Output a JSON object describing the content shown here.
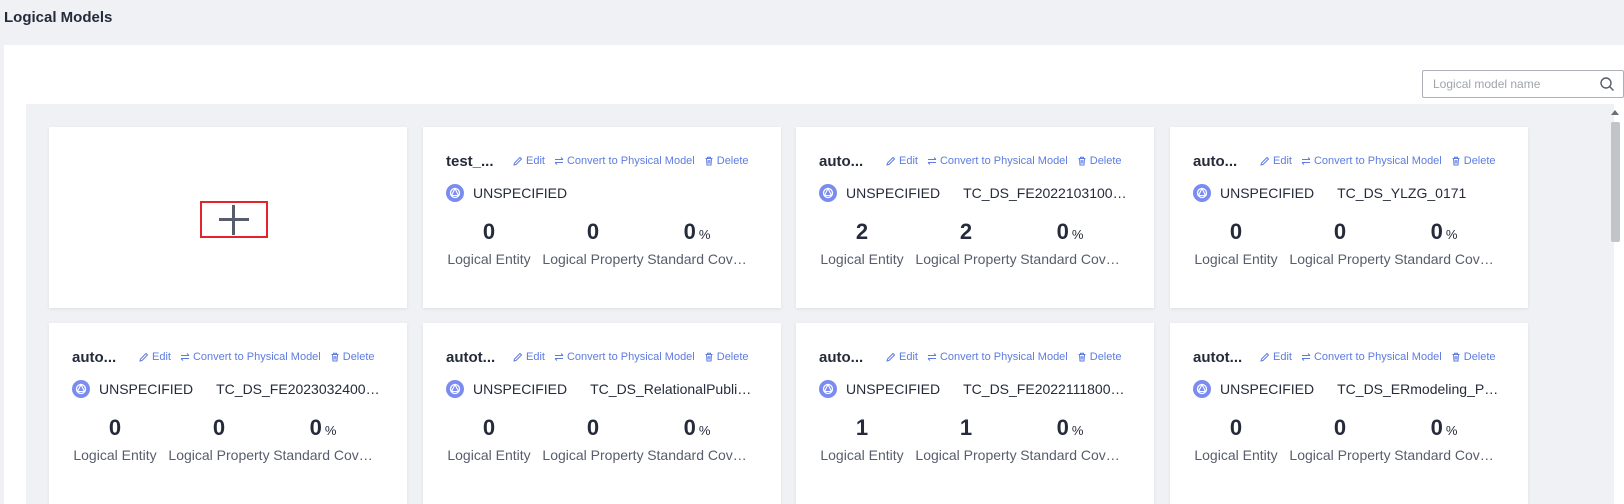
{
  "page": {
    "title": "Logical Models"
  },
  "search": {
    "placeholder": "Logical model name"
  },
  "labels": {
    "edit": "Edit",
    "convert": "Convert to Physical Model",
    "delete": "Delete",
    "entity": "Logical Entity",
    "property": "Logical Property",
    "coverage": "Standard Cov…",
    "percent": "%"
  },
  "cards": [
    {
      "name": "test_...",
      "status": "UNSPECIFIED",
      "datasource": "",
      "entity": "0",
      "property": "0",
      "coverage": "0"
    },
    {
      "name": "auto...",
      "status": "UNSPECIFIED",
      "datasource": "TC_DS_FE20221031003...",
      "entity": "2",
      "property": "2",
      "coverage": "0"
    },
    {
      "name": "auto...",
      "status": "UNSPECIFIED",
      "datasource": "TC_DS_YLZG_0171",
      "entity": "0",
      "property": "0",
      "coverage": "0"
    },
    {
      "name": "auto...",
      "status": "UNSPECIFIED",
      "datasource": "TC_DS_FE20230324001...",
      "entity": "0",
      "property": "0",
      "coverage": "0"
    },
    {
      "name": "autot...",
      "status": "UNSPECIFIED",
      "datasource": "TC_DS_RelationalPublish...",
      "entity": "0",
      "property": "0",
      "coverage": "0"
    },
    {
      "name": "auto...",
      "status": "UNSPECIFIED",
      "datasource": "TC_DS_FE20221118000...",
      "entity": "1",
      "property": "1",
      "coverage": "0"
    },
    {
      "name": "autot...",
      "status": "UNSPECIFIED",
      "datasource": "TC_DS_ERmodeling_Phy...",
      "entity": "0",
      "property": "0",
      "coverage": "0"
    }
  ],
  "colors": {
    "link": "#5e7ce0",
    "accent_border": "#e4232d",
    "icon_circle": "#7b8cf0"
  }
}
